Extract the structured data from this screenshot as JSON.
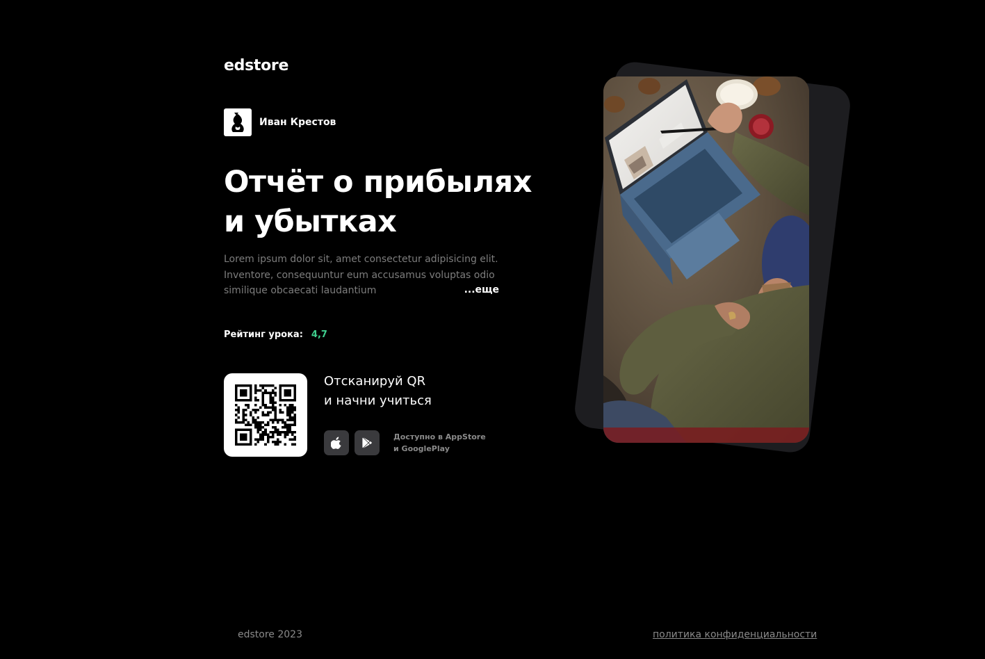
{
  "header": {
    "logo": "edstore"
  },
  "author": {
    "name": "Иван Крестов"
  },
  "lesson": {
    "title_line1": "Отчёт о прибылях",
    "title_line2": "и убытках",
    "description": "Lorem ipsum dolor sit, amet consectetur adipisicing elit. Inventore, consequuntur eum accusamus voluptas odio similique obcaecati laudantium",
    "more_label": "...еще",
    "rating_label": "Рейтинг урока:",
    "rating_value": "4,7"
  },
  "qr": {
    "title_line1": "Отсканируй QR",
    "title_line2": "и начни учиться",
    "caption_line1": "Доступно в AppStore",
    "caption_line2": "и GooglePlay"
  },
  "stores": [
    {
      "icon": "apple-icon"
    },
    {
      "icon": "google-play-icon"
    }
  ],
  "footer": {
    "copyright": "edstore 2023",
    "privacy_link": "политика конфиденциальности"
  },
  "colors": {
    "background": "#000000",
    "text": "#ffffff",
    "muted": "#7d7d7d",
    "rating": "#3fcf8e",
    "store_button": "#3a3a3d",
    "photo_backdrop": "#1d1d20"
  }
}
